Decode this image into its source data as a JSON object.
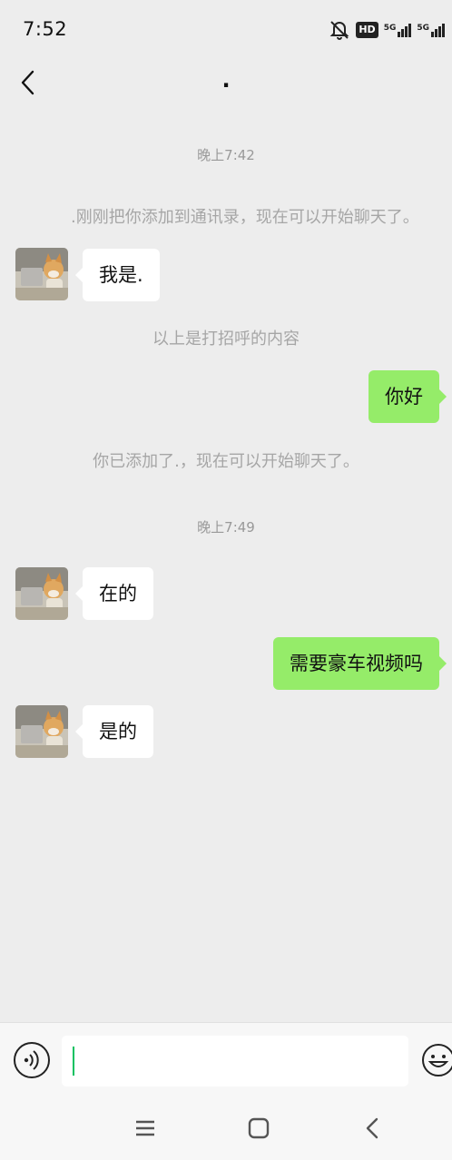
{
  "status_bar": {
    "time": "7:52",
    "hd_label": "HD",
    "network_1": "5G",
    "network_2": "5G"
  },
  "header": {
    "title": "."
  },
  "messages": [
    {
      "type": "time",
      "text": "晚上7:42"
    },
    {
      "type": "system",
      "text": ".刚刚把你添加到通讯录，现在可以开始聊天了。"
    },
    {
      "type": "incoming",
      "text": "我是."
    },
    {
      "type": "system",
      "text": "以上是打招呼的内容"
    },
    {
      "type": "outgoing",
      "text": "你好"
    },
    {
      "type": "system",
      "text": "你已添加了.，现在可以开始聊天了。"
    },
    {
      "type": "time",
      "text": "晚上7:49"
    },
    {
      "type": "incoming",
      "text": "在的"
    },
    {
      "type": "outgoing",
      "text": "需要豪车视频吗"
    },
    {
      "type": "incoming",
      "text": "是的"
    }
  ],
  "input": {
    "value": "",
    "voice_icon": "voice-icon",
    "emoji_icon": "emoji-icon"
  },
  "colors": {
    "background": "#ededed",
    "outgoing_bubble": "#95ec69",
    "incoming_bubble": "#ffffff",
    "caret": "#07c160"
  }
}
